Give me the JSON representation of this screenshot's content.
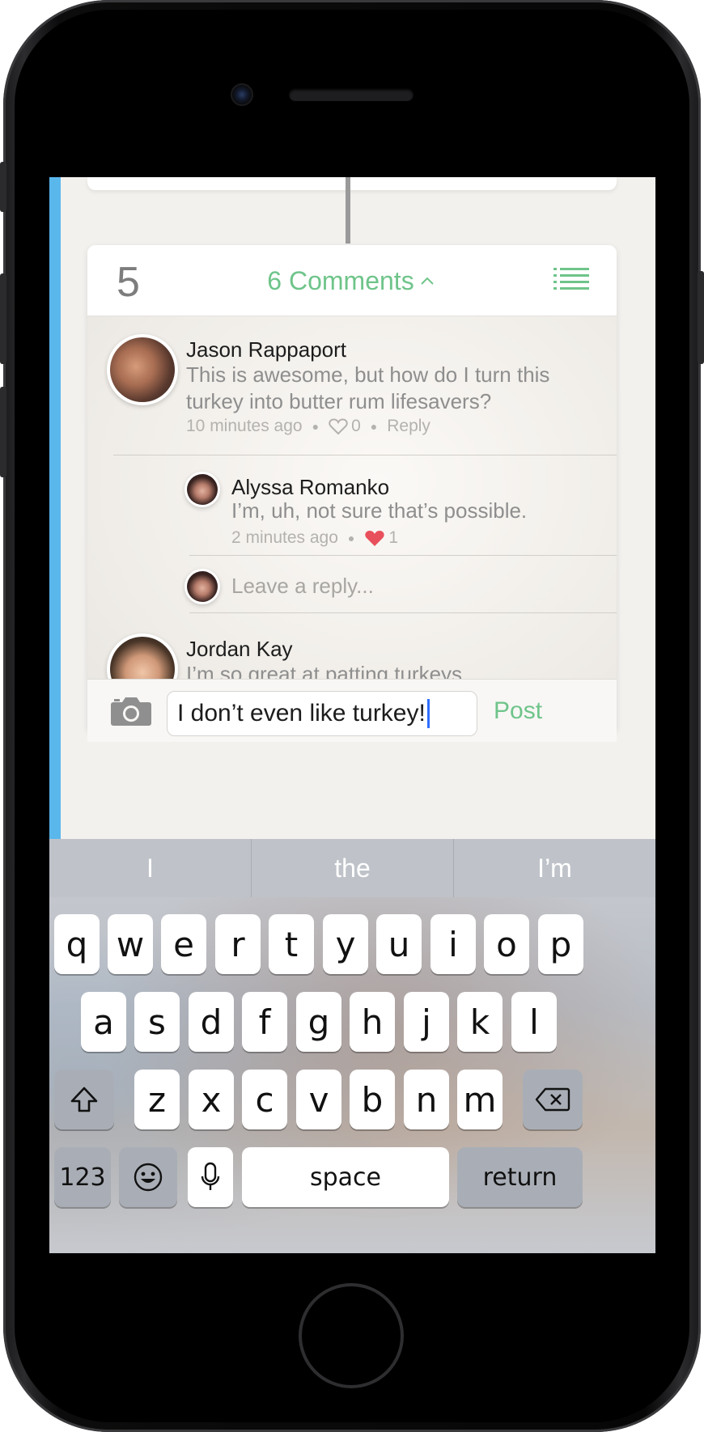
{
  "card": {
    "number": "5",
    "comments_label": "6 Comments"
  },
  "comments": [
    {
      "name": "Jason Rappaport",
      "text_line1": "This is awesome, but how do I turn this",
      "text_line2": "turkey into butter rum lifesavers?",
      "time": "10 minutes ago",
      "likes": "0",
      "reply": "Reply"
    },
    {
      "name": "Alyssa Romanko",
      "text": "I’m, uh, not sure that’s possible.",
      "time": "2 minutes ago",
      "likes": "1"
    },
    {
      "name": "Jordan Kay",
      "text": "I’m so great at patting turkeys."
    }
  ],
  "reply_field": {
    "placeholder": "Leave a reply..."
  },
  "composer": {
    "value": "I don’t even like turkey!",
    "post_label": "Post"
  },
  "keyboard": {
    "suggestions": [
      "I",
      "the",
      "I’m"
    ],
    "row1": [
      "q",
      "w",
      "e",
      "r",
      "t",
      "y",
      "u",
      "i",
      "o",
      "p"
    ],
    "row2": [
      "a",
      "s",
      "d",
      "f",
      "g",
      "h",
      "j",
      "k",
      "l"
    ],
    "row3": [
      "z",
      "x",
      "c",
      "v",
      "b",
      "n",
      "m"
    ],
    "numbers_label": "123",
    "space_label": "space",
    "return_label": "return"
  },
  "colors": {
    "accent_green": "#6fc48a",
    "timeline_blue": "#5ab7ec",
    "like_red": "#e8505b"
  },
  "icons": [
    "camera-icon",
    "list-icon",
    "chevron-up-icon",
    "heart-outline-icon",
    "heart-filled-icon",
    "shift-icon",
    "delete-icon",
    "emoji-icon",
    "microphone-icon"
  ]
}
